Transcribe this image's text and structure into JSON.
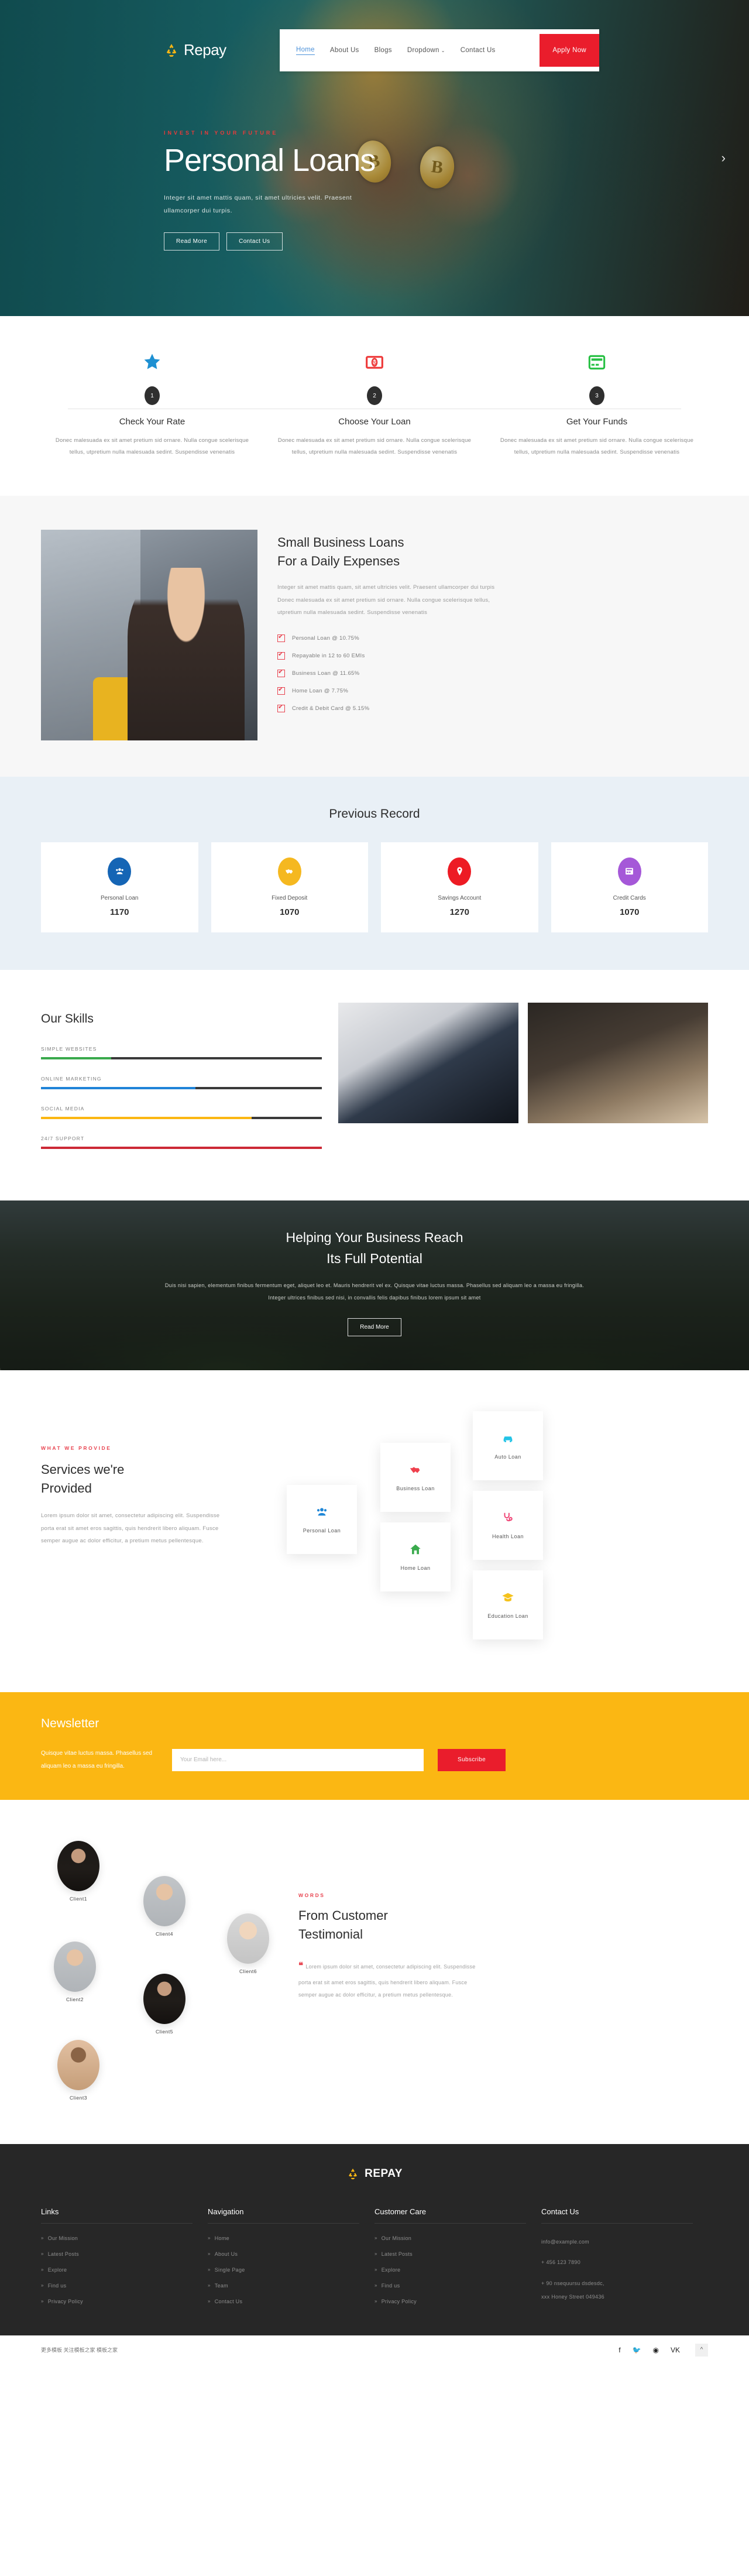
{
  "brand": {
    "name": "Repay",
    "footer_name": "REPAY",
    "logo_icon": "recycle-icon"
  },
  "nav": {
    "items": [
      {
        "label": "Home",
        "active": true
      },
      {
        "label": "About Us",
        "active": false
      },
      {
        "label": "Blogs",
        "active": false
      },
      {
        "label": "Dropdown",
        "active": false,
        "caret": "⌄"
      },
      {
        "label": "Contact Us",
        "active": false
      }
    ],
    "cta_label": "Apply Now"
  },
  "hero": {
    "kicker": "INVEST IN YOUR FUTURE",
    "title": "Personal Loans",
    "subtitle": "Integer sit amet mattis quam, sit amet ultricies velit. Praesent ullamcorper dui turpis.",
    "btn_primary": "Read More",
    "btn_secondary": "Contact Us",
    "next_arrow": "›"
  },
  "steps": [
    {
      "num": "1",
      "icon": "star-icon",
      "icon_color": "#1e90d2",
      "title": "Check Your Rate",
      "desc": "Donec malesuada ex sit amet pretium sid ornare. Nulla congue scelerisque tellus, utpretium nulla malesuada sedint. Suspendisse venenatis"
    },
    {
      "num": "2",
      "icon": "money-icon",
      "icon_color": "#ee3b3b",
      "title": "Choose Your Loan",
      "desc": "Donec malesuada ex sit amet pretium sid ornare. Nulla congue scelerisque tellus, utpretium nulla malesuada sedint. Suspendisse venenatis"
    },
    {
      "num": "3",
      "icon": "card-icon",
      "icon_color": "#27c043",
      "title": "Get Your Funds",
      "desc": "Donec malesuada ex sit amet pretium sid ornare. Nulla congue scelerisque tellus, utpretium nulla malesuada sedint. Suspendisse venenatis"
    }
  ],
  "small_business": {
    "title_line1": "Small Business Loans",
    "title_line2": "For a Daily Expenses",
    "desc": "Integer sit amet mattis quam, sit amet ultricies velit. Praesent ullamcorper dui turpis Donec malesuada ex sit amet pretium sid ornare. Nulla congue scelerisque tellus, utpretium nulla malesuada sedint. Suspendisse venenatis",
    "items": [
      "Personal Loan @ 10.75%",
      "Repayable in 12 to 60 EMIs",
      "Business Loan @ 11.65%",
      "Home Loan @ 7.75%",
      "Credit & Debit Card @ 5.15%"
    ]
  },
  "record": {
    "title": "Previous Record",
    "cards": [
      {
        "label": "Personal Loan",
        "value": "1170",
        "icon": "users-icon",
        "color": "#1565b5"
      },
      {
        "label": "Fixed Deposit",
        "value": "1070",
        "icon": "handshake-icon",
        "color": "#f5b820"
      },
      {
        "label": "Savings Account",
        "value": "1270",
        "icon": "pin-icon",
        "color": "#ed1b24"
      },
      {
        "label": "Credit Cards",
        "value": "1070",
        "icon": "card-icon",
        "color": "#a558d8"
      }
    ]
  },
  "skills": {
    "title": "Our Skills",
    "items": [
      {
        "label": "SIMPLE WEBSITES",
        "percent": 25,
        "color": "#3aaa4d"
      },
      {
        "label": "ONLINE MARKETING",
        "percent": 55,
        "color": "#2084d8"
      },
      {
        "label": "SOCIAL MEDIA",
        "percent": 75,
        "color": "#fbb713"
      },
      {
        "label": "24/7 SUPPORT",
        "percent": 100,
        "color": "#cc2936"
      }
    ]
  },
  "cta": {
    "title_line1": "Helping Your Business Reach",
    "title_line2": "Its Full Potential",
    "desc": "Duis nisi sapien, elementum finibus fermentum eget, aliquet leo et. Mauris hendrerit vel ex. Quisque vitae luctus massa. Phasellus sed aliquam leo a massa eu fringilla. Integer ultrices finibus sed nisi, in convallis felis dapibus finibus lorem ipsum sit amet",
    "btn": "Read More"
  },
  "services": {
    "kicker": "WHAT WE PROVIDE",
    "title_line1": "Services we're",
    "title_line2": "Provided",
    "desc": "Lorem ipsum dolor sit amet, consectetur adipiscing elit. Suspendisse porta erat sit amet eros sagittis, quis hendrerit libero aliquam. Fusce semper augue ac dolor efficitur, a pretium metus pellentesque.",
    "cards": [
      {
        "label": "Personal Loan",
        "icon": "users-icon",
        "color": "#1f86d6"
      },
      {
        "label": "Business Loan",
        "icon": "handshake-icon",
        "color": "#ef404d"
      },
      {
        "label": "Home Loan",
        "icon": "home-icon",
        "color": "#3aaa4d"
      },
      {
        "label": "Auto Loan",
        "icon": "car-icon",
        "color": "#22c3e6"
      },
      {
        "label": "Health Loan",
        "icon": "stethoscope-icon",
        "color": "#ef4072"
      },
      {
        "label": "Education Loan",
        "icon": "graduation-icon",
        "color": "#f5c21c"
      }
    ]
  },
  "newsletter": {
    "title": "Newsletter",
    "desc": "Quisque vitae luctus massa. Phasellus sed aliquam leo a massa eu fringilla.",
    "placeholder": "Your Email here...",
    "btn": "Subscribe"
  },
  "testimonial": {
    "kicker": "WORDS",
    "title_line1": "From Customer",
    "title_line2": "Testimonial",
    "quote": "Lorem ipsum dolor sit amet, consectetur adipiscing elit. Suspendisse porta erat sit amet eros sagittis, quis hendrerit libero aliquam. Fusce semper augue ac dolor efficitur, a pretium metus pellentesque.",
    "quote_mark": "❝",
    "clients": [
      {
        "name": "Client1",
        "style": "a-dark"
      },
      {
        "name": "Client2",
        "style": "a-gray"
      },
      {
        "name": "Client3",
        "style": "a-warm"
      },
      {
        "name": "Client4",
        "style": "a-gray"
      },
      {
        "name": "Client5",
        "style": "a-dark"
      },
      {
        "name": "Client6",
        "style": "a-light"
      }
    ]
  },
  "footer": {
    "columns": [
      {
        "heading": "Links",
        "links": [
          "Our Mission",
          "Latest Posts",
          "Explore",
          "Find us",
          "Privacy Policy"
        ]
      },
      {
        "heading": "Navigation",
        "links": [
          "Home",
          "About Us",
          "Single Page",
          "Team",
          "Contact Us"
        ]
      },
      {
        "heading": "Customer Care",
        "links": [
          "Our Mission",
          "Latest Posts",
          "Explore",
          "Find us",
          "Privacy Policy"
        ]
      }
    ],
    "contact": {
      "heading": "Contact Us",
      "email": "info@example.com",
      "phone": "+ 456 123 7890",
      "address_line1": "+ 90 nsequursu dsdesdc,",
      "address_line2": "xxx Honey Street 049436"
    },
    "copyright": "更多模板 关注模板之家 模板之家",
    "social": [
      "f",
      "🐦",
      "◉",
      "VK"
    ],
    "back_to_top": "^"
  }
}
